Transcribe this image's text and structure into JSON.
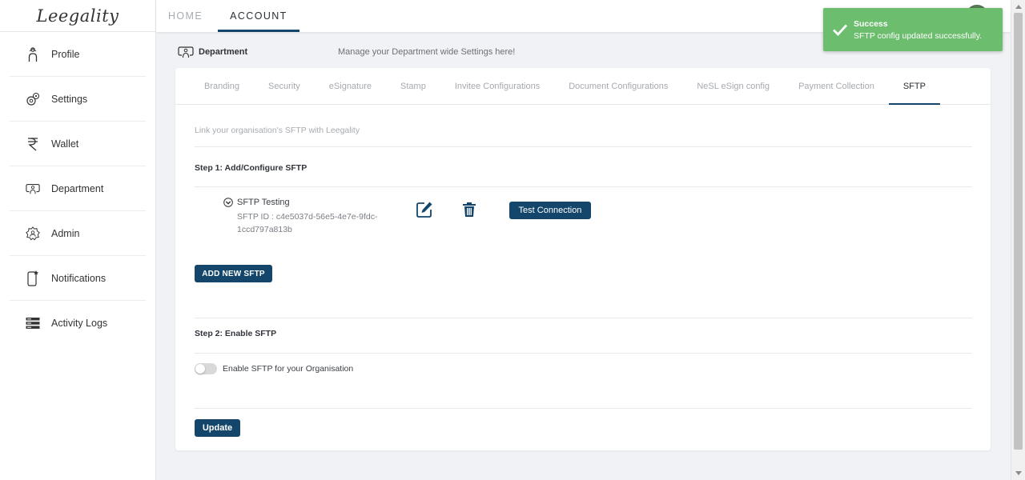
{
  "sidebar": {
    "logo": "Leegality",
    "items": [
      {
        "label": "Profile",
        "icon": "profile-icon"
      },
      {
        "label": "Settings",
        "icon": "settings-icon"
      },
      {
        "label": "Wallet",
        "icon": "rupee-icon"
      },
      {
        "label": "Department",
        "icon": "department-icon"
      },
      {
        "label": "Admin",
        "icon": "admin-icon"
      },
      {
        "label": "Notifications",
        "icon": "notification-icon"
      },
      {
        "label": "Activity Logs",
        "icon": "activity-logs-icon"
      }
    ]
  },
  "topbar": {
    "tabs": [
      {
        "label": "HOME",
        "active": false
      },
      {
        "label": "ACCOUNT",
        "active": true
      }
    ]
  },
  "header": {
    "title": "Department",
    "subtitle": "Manage your Department wide Settings here!"
  },
  "tabs": [
    {
      "label": "Branding",
      "active": false
    },
    {
      "label": "Security",
      "active": false
    },
    {
      "label": "eSignature",
      "active": false
    },
    {
      "label": "Stamp",
      "active": false
    },
    {
      "label": "Invitee Configurations",
      "active": false
    },
    {
      "label": "Document Configurations",
      "active": false
    },
    {
      "label": "NeSL eSign config",
      "active": false
    },
    {
      "label": "Payment Collection",
      "active": false
    },
    {
      "label": "SFTP",
      "active": true
    }
  ],
  "sftp": {
    "intro": "Link your organisation's SFTP with Leegality",
    "step1_title": "Step 1: Add/Configure SFTP",
    "entry": {
      "name": "SFTP Testing",
      "id_line1": "SFTP ID : c4e5037d-56e5-4e7e-9fdc-",
      "id_line2": "1ccd797a813b"
    },
    "test_connection_label": "Test Connection",
    "add_new_label": "ADD NEW SFTP",
    "step2_title": "Step 2: Enable SFTP",
    "enable_label": "Enable SFTP for your Organisation",
    "enabled": false,
    "update_label": "Update"
  },
  "toast": {
    "title": "Success",
    "message": "SFTP config updated successfully.",
    "color": "#6cbd6e"
  },
  "colors": {
    "primary": "#14466c",
    "success": "#6cbd6e"
  }
}
